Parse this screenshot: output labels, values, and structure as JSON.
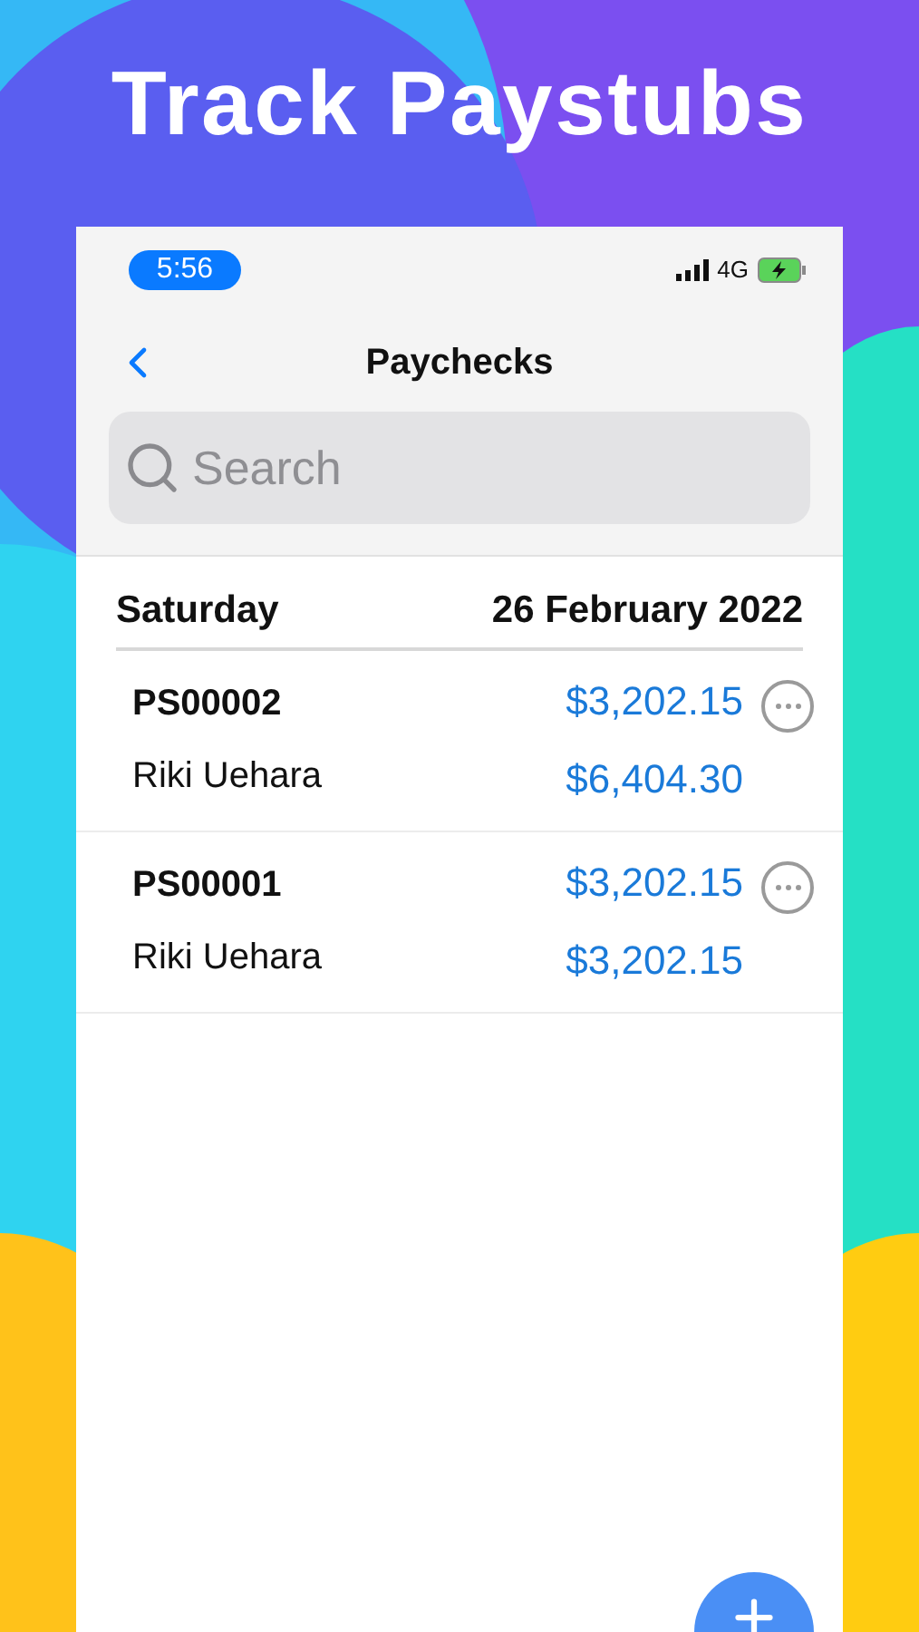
{
  "headline": "Track Paystubs",
  "status_bar": {
    "time": "5:56",
    "network": "4G"
  },
  "nav": {
    "title": "Paychecks"
  },
  "search": {
    "placeholder": "Search"
  },
  "section": {
    "day": "Saturday",
    "date": "26 February 2022"
  },
  "paychecks": [
    {
      "id": "PS00002",
      "name": "Riki Uehara",
      "amount": "$3,202.15",
      "total": "$6,404.30"
    },
    {
      "id": "PS00001",
      "name": "Riki Uehara",
      "amount": "$3,202.15",
      "total": "$3,202.15"
    }
  ]
}
